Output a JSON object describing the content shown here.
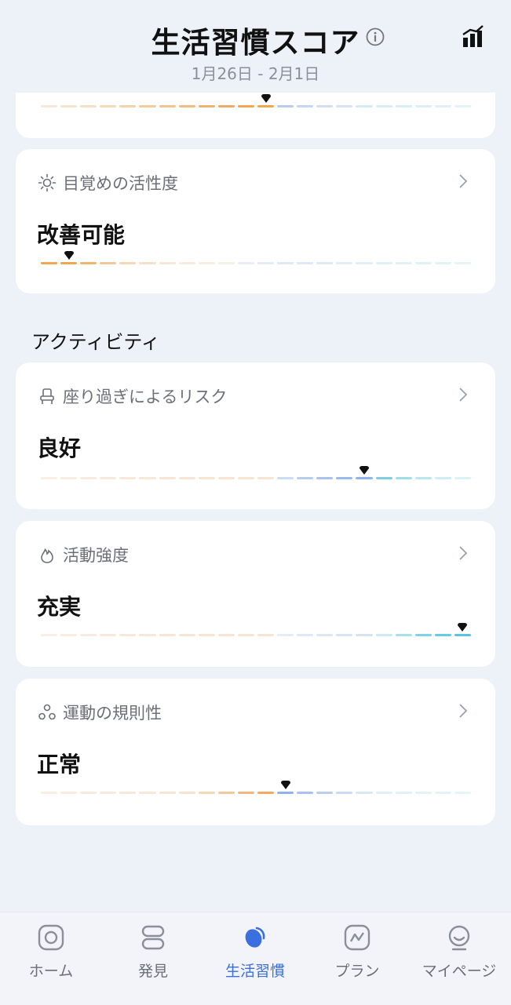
{
  "header": {
    "title": "生活習慣スコア",
    "date_range": "1月26日 - 2月1日",
    "info_icon": "info-circle-icon",
    "chart_icon": "bar-chart-icon"
  },
  "cards": [
    {
      "id": "top-partial",
      "label": "",
      "status": "",
      "marker_index": 11,
      "segments": [
        "#f6e7d6",
        "#f6e3cd",
        "#f5dfc5",
        "#f5d9b8",
        "#f4d3ab",
        "#f3cc9e",
        "#f3c491",
        "#f1bd83",
        "#efb271",
        "#eeaa62",
        "#f0a850",
        "#f0a64c",
        "#b7cdf0",
        "#c5d6f3",
        "#d1dff5",
        "#d4e4f6",
        "#d6eaf4",
        "#d6eef2",
        "#d6eff3",
        "#daf0f4",
        "#dff1f5",
        "#e1f3f6"
      ]
    },
    {
      "id": "wake-activity",
      "label": "目覚めの活性度",
      "icon": "sun-icon",
      "status": "改善可能",
      "marker_index": 1,
      "segments": [
        "#f0a650",
        "#f0a650",
        "#f1b570",
        "#f3c797",
        "#f5d8b8",
        "#f6e0c8",
        "#f7e6d4",
        "#f8ebdc",
        "#f8eee2",
        "#f8efe5",
        "#e8eef8",
        "#e3ebf7",
        "#dfe8f6",
        "#dfe9f6",
        "#dfeaf6",
        "#e0edf5",
        "#e0eff5",
        "#e0f0f5",
        "#e0f1f5",
        "#e1f2f6",
        "#e2f3f6",
        "#e4f4f7"
      ]
    },
    {
      "id": "sitting-risk",
      "label": "座り過ぎによるリスク",
      "icon": "seat-icon",
      "status": "良好",
      "marker_index": 16,
      "segments": [
        "#f8eee2",
        "#f8ece0",
        "#f8eadd",
        "#f8e9da",
        "#f8e8d8",
        "#f8e7d6",
        "#f8e6d4",
        "#f8e6d2",
        "#f8e5d1",
        "#f8e5d1",
        "#f8e5d1",
        "#f8e5d1",
        "#c9dbf5",
        "#b7cdf0",
        "#a9c3ef",
        "#9bbbed",
        "#8fb3ec",
        "#7ecfe6",
        "#9edfe8",
        "#b9e7ee",
        "#cdeef3",
        "#dcf3f6"
      ]
    },
    {
      "id": "activity-intensity",
      "label": "活動強度",
      "icon": "flame-icon",
      "status": "充実",
      "marker_index": 21,
      "segments": [
        "#f8eee2",
        "#f8ece0",
        "#f8eadd",
        "#f8e9da",
        "#f8e8d8",
        "#f8e7d6",
        "#f8e6d4",
        "#f8e6d2",
        "#f8e5d1",
        "#f8e5d1",
        "#f8e5d1",
        "#f8e5d1",
        "#e4ecf8",
        "#dfe8f7",
        "#dbe6f6",
        "#d8e4f6",
        "#d4e4f5",
        "#cdeaf2",
        "#a8e0ec",
        "#7fd3e8",
        "#64cce5",
        "#55c6e2"
      ]
    },
    {
      "id": "exercise-regularity",
      "label": "運動の規則性",
      "icon": "triangle-circles-icon",
      "status": "正常",
      "marker_index": 12,
      "segments": [
        "#f8eee2",
        "#f8ece0",
        "#f8eadd",
        "#f8e9da",
        "#f8e8d8",
        "#f8e7d6",
        "#f8e6d4",
        "#f8e3cd",
        "#f6d7b6",
        "#f4c99c",
        "#f1b77c",
        "#f0ab63",
        "#8fb3ec",
        "#a7c2ef",
        "#b9cff2",
        "#c9daf5",
        "#d8e8f5",
        "#e0f0f5",
        "#e1f2f6",
        "#e2f3f6",
        "#e3f4f7",
        "#e5f5f7"
      ]
    }
  ],
  "section": {
    "activity_title": "アクティビティ"
  },
  "tabs": [
    {
      "label": "ホーム",
      "icon": "home-circle-icon",
      "active": false
    },
    {
      "label": "発見",
      "icon": "discover-icon",
      "active": false
    },
    {
      "label": "生活習慣",
      "icon": "lifestyle-icon",
      "active": true
    },
    {
      "label": "プラン",
      "icon": "plan-icon",
      "active": false
    },
    {
      "label": "マイページ",
      "icon": "profile-icon",
      "active": false
    }
  ],
  "colors": {
    "accent": "#3a6fe0",
    "background": "#edf1f8"
  }
}
